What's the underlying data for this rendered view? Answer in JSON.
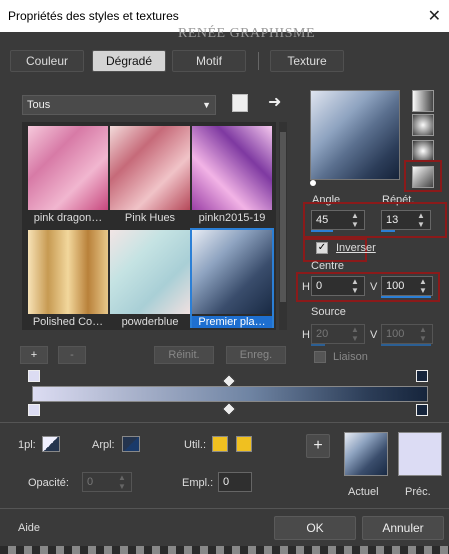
{
  "window": {
    "title": "Propriétés des styles et textures",
    "watermark": "RENÉE GRAPHISME",
    "close_icon": "close-icon"
  },
  "tabs": [
    {
      "label": "Couleur",
      "active": false
    },
    {
      "label": "Dégradé",
      "active": true
    },
    {
      "label": "Motif",
      "active": false
    },
    {
      "label": "Texture",
      "active": false
    }
  ],
  "category": {
    "value": "Tous"
  },
  "gallery": [
    {
      "label": "pink dragon…"
    },
    {
      "label": "Pink Hues"
    },
    {
      "label": "pinkn2015-19"
    },
    {
      "label": "Polished Co…"
    },
    {
      "label": "powderblue"
    },
    {
      "label": "Premier pla…",
      "selected": true
    }
  ],
  "buttons": {
    "add": "+",
    "remove": "-",
    "reset": "Réinit.",
    "save": "Enreg."
  },
  "angle": {
    "label": "Angle",
    "value": "45"
  },
  "repeat": {
    "label": "Répét.",
    "value": "13"
  },
  "invert": {
    "label": "Inverser",
    "checked": true
  },
  "center": {
    "label": "Centre",
    "h_label": "H",
    "h_value": "0",
    "v_label": "V",
    "v_value": "100"
  },
  "source": {
    "label": "Source",
    "h_label": "H",
    "h_value": "20",
    "v_label": "V",
    "v_value": "100"
  },
  "link": {
    "label": "Liaison"
  },
  "bottom": {
    "fg_label": "1pl:",
    "bg_label": "Arpl:",
    "use_label": "Util.:",
    "opacity_label": "Opacité:",
    "opacity_value": "0",
    "loc_label": "Empl.:",
    "loc_value": "0",
    "current_label": "Actuel",
    "previous_label": "Préc.",
    "add_symbol": "+"
  },
  "footer": {
    "help": "Aide",
    "ok": "OK",
    "cancel": "Annuler"
  },
  "colors": {
    "accent": "#2b7fd6",
    "highlight": "#8b1a1a",
    "use_color": "#f0c020"
  }
}
